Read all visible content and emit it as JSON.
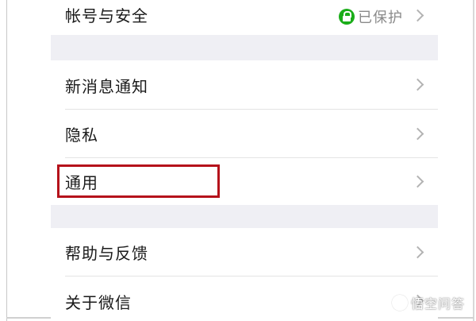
{
  "settings": {
    "account_security": {
      "label": "帐号与安全",
      "status": "已保护"
    },
    "items_group2": [
      {
        "label": "新消息通知"
      },
      {
        "label": "隐私"
      },
      {
        "label": "通用"
      }
    ],
    "items_group3": [
      {
        "label": "帮助与反馈"
      },
      {
        "label": "关于微信"
      }
    ]
  },
  "watermark": {
    "text": "悟空问答"
  },
  "colors": {
    "highlight": "#b5121b",
    "lock_green": "#1aad19",
    "separator_bg": "#efeff4"
  }
}
